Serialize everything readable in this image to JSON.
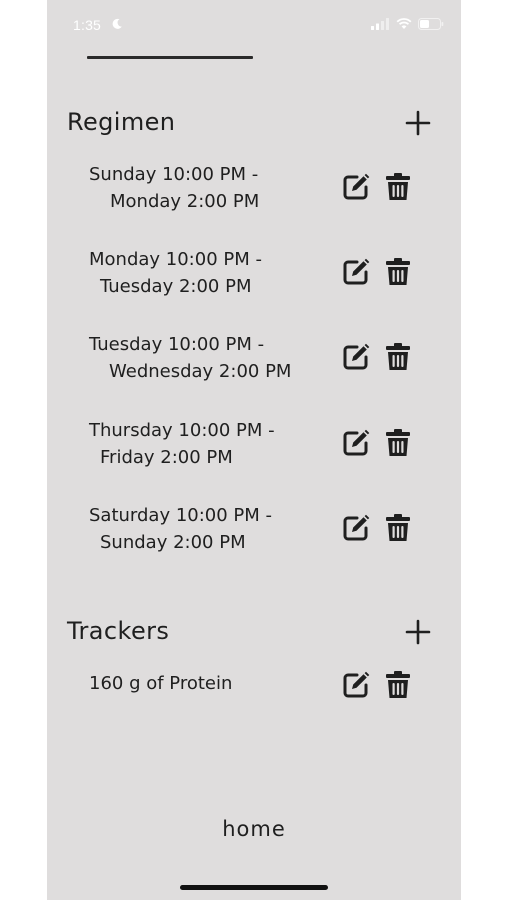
{
  "status_bar": {
    "time": "1:35",
    "icons": [
      "moon-icon",
      "cellular-signal-icon",
      "wifi-icon",
      "battery-icon"
    ]
  },
  "regimen": {
    "title": "Regimen",
    "add_icon": "plus-icon",
    "items": [
      {
        "line1": "Sunday 10:00 PM -",
        "line2": "Monday 2:00 PM"
      },
      {
        "line1": "Monday 10:00 PM -",
        "line2": "Tuesday 2:00 PM"
      },
      {
        "line1": "Tuesday 10:00 PM -",
        "line2": "Wednesday 2:00 PM"
      },
      {
        "line1": "Thursday 10:00 PM -",
        "line2": "Friday 2:00 PM"
      },
      {
        "line1": "Saturday 10:00 PM -",
        "line2": "Sunday 2:00 PM"
      }
    ]
  },
  "trackers": {
    "title": "Trackers",
    "add_icon": "plus-icon",
    "items": [
      {
        "label": "160 g of Protein"
      }
    ]
  },
  "item_actions": {
    "edit_icon": "edit-icon",
    "delete_icon": "trash-icon"
  },
  "footer": {
    "home_label": "home"
  },
  "colors": {
    "background": "#dfdddd",
    "text": "#1f1f1f",
    "status_text": "#ffffff"
  }
}
